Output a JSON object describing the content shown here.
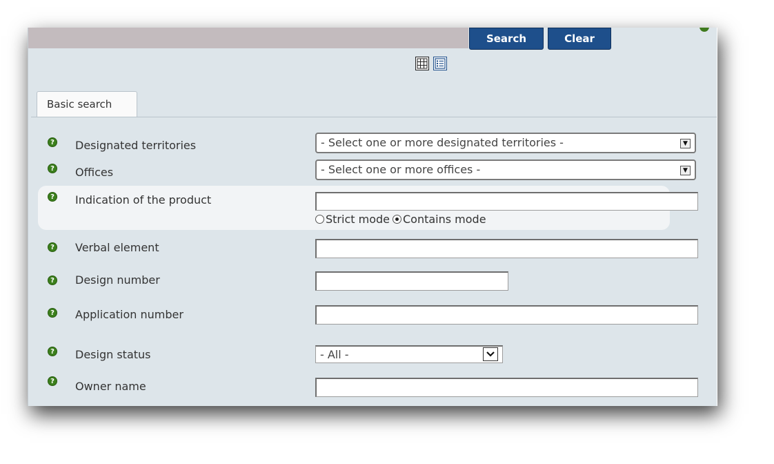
{
  "toolbar": {
    "search_label": "Search",
    "clear_label": "Clear"
  },
  "view_icons": [
    "grid-view-icon",
    "list-view-icon"
  ],
  "tabs": [
    {
      "label": "Basic search"
    }
  ],
  "help_glyph": "?",
  "fields": {
    "designated_territories": {
      "label": "Designated territories",
      "value": "- Select one or more designated territories -"
    },
    "offices": {
      "label": "Offices",
      "value": "- Select one or more offices -"
    },
    "indication_of_product": {
      "label": "Indication of the product",
      "value": "",
      "modes": {
        "strict": "Strict mode",
        "contains": "Contains mode",
        "selected": "contains"
      }
    },
    "verbal_element": {
      "label": "Verbal element",
      "value": ""
    },
    "design_number": {
      "label": "Design number",
      "value": ""
    },
    "application_number": {
      "label": "Application number",
      "value": ""
    },
    "design_status": {
      "label": "Design status",
      "value": "- All -"
    },
    "owner_name": {
      "label": "Owner name",
      "value": ""
    }
  },
  "colors": {
    "panel_bg": "#dde5ea",
    "button_bg": "#1e4f8b",
    "help_green": "#3b7f1c",
    "top_bar": "#c3bbbe"
  }
}
